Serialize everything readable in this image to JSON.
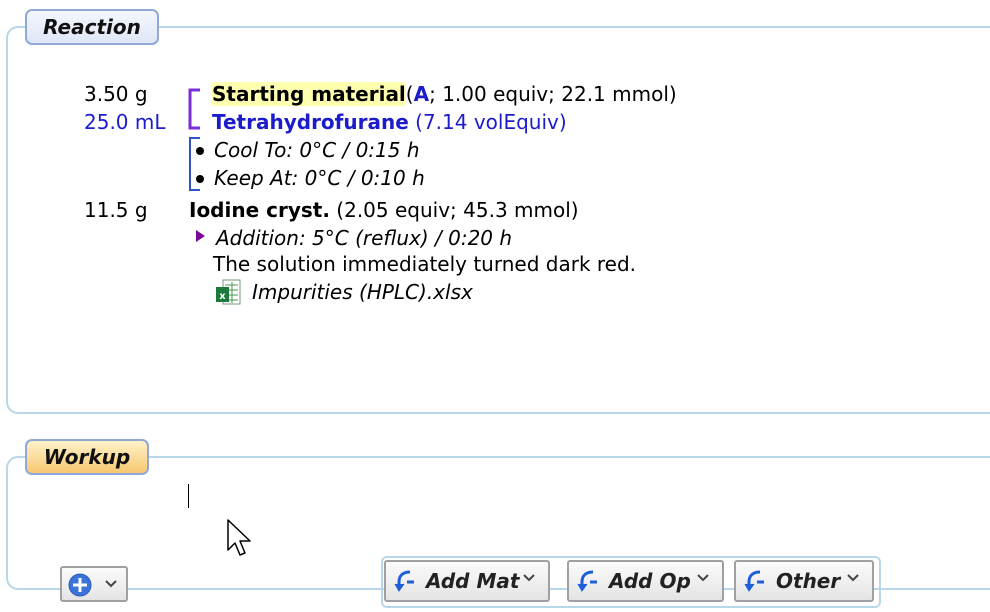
{
  "sections": {
    "reaction_label": "Reaction",
    "workup_label": "Workup"
  },
  "reaction": {
    "items": [
      {
        "amount": "3.50 g",
        "name": "Starting material",
        "ref_open": "(",
        "ref": "A",
        "details": "; 1.00 equiv; 22.1 mmol)"
      },
      {
        "amount": "25.0 mL",
        "name": "Tetrahydrofurane",
        "details": "(7.14 volEquiv)"
      }
    ],
    "ops": [
      {
        "text": "Cool To: 0°C / 0:15 h"
      },
      {
        "text": "Keep At: 0°C / 0:10 h"
      }
    ],
    "iodine": {
      "amount": "11.5 g",
      "name": "Iodine cryst.",
      "details": "(2.05 equiv; 45.3 mmol)"
    },
    "addition": "Addition: 5°C (reflux) / 0:20 h",
    "comment": "The solution immediately turned dark red.",
    "attachment": "Impurities (HPLC).xlsx"
  },
  "toolbar": {
    "add_mat": "Add Mat",
    "add_op": "Add Op",
    "other": "Other"
  },
  "colors": {
    "accent_blue": "#1c1ccc",
    "bracket_purple": "#7a2fd6",
    "highlight": "#ffffb0",
    "frame": "#b8d7e8"
  }
}
